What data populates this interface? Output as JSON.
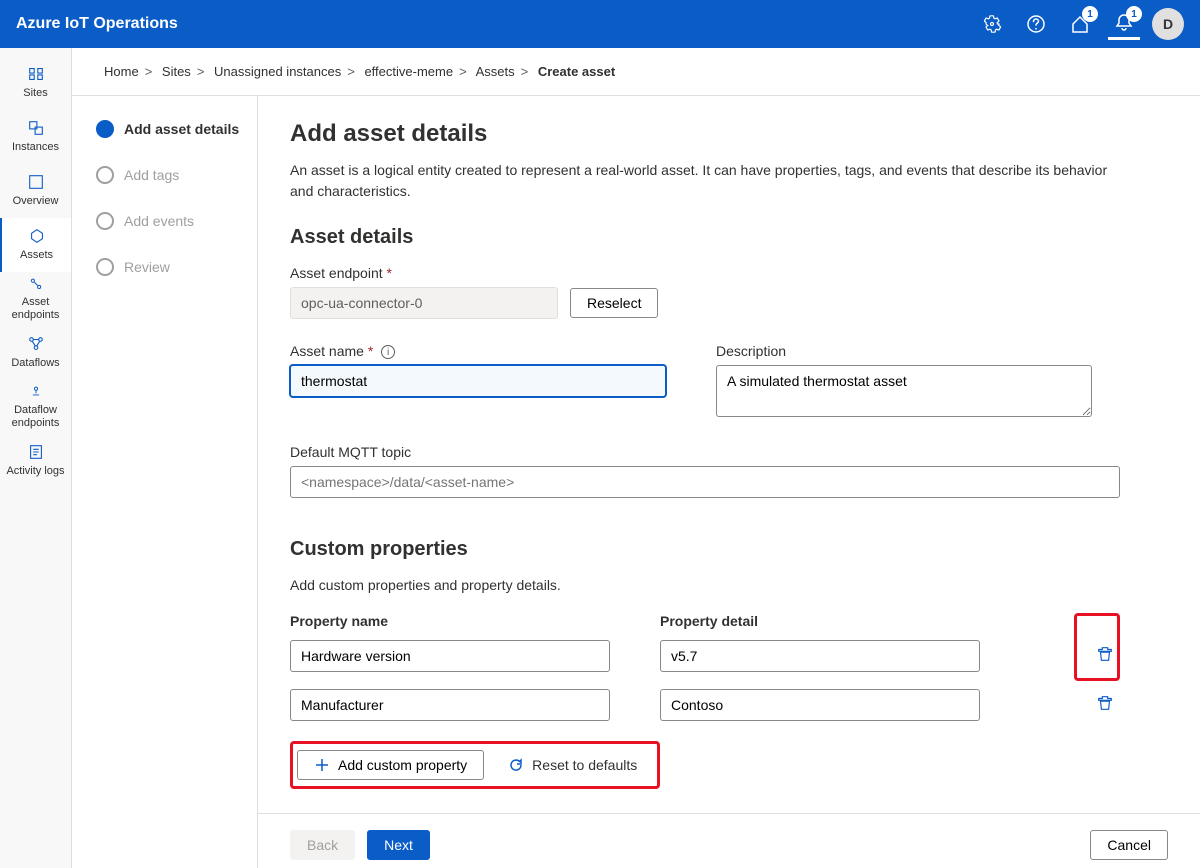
{
  "header": {
    "title": "Azure IoT Operations",
    "badge1": "1",
    "badge2": "1",
    "avatar": "D"
  },
  "sidebar": {
    "items": [
      {
        "label": "Sites"
      },
      {
        "label": "Instances"
      },
      {
        "label": "Overview"
      },
      {
        "label": "Assets"
      },
      {
        "label": "Asset endpoints"
      },
      {
        "label": "Dataflows"
      },
      {
        "label": "Dataflow endpoints"
      },
      {
        "label": "Activity logs"
      }
    ]
  },
  "breadcrumb": {
    "items": [
      "Home",
      "Sites",
      "Unassigned instances",
      "effective-meme",
      "Assets"
    ],
    "current": "Create asset"
  },
  "steps": [
    {
      "label": "Add asset details"
    },
    {
      "label": "Add tags"
    },
    {
      "label": "Add events"
    },
    {
      "label": "Review"
    }
  ],
  "page": {
    "title": "Add asset details",
    "description": "An asset is a logical entity created to represent a real-world asset. It can have properties, tags, and events that describe its behavior and characteristics."
  },
  "details": {
    "sectionTitle": "Asset details",
    "endpointLabel": "Asset endpoint",
    "endpointValue": "opc-ua-connector-0",
    "reselectLabel": "Reselect",
    "nameLabel": "Asset name",
    "nameValue": "thermostat",
    "descLabel": "Description",
    "descValue": "A simulated thermostat asset",
    "mqttLabel": "Default MQTT topic",
    "mqttPlaceholder": "<namespace>/data/<asset-name>"
  },
  "customProps": {
    "sectionTitle": "Custom properties",
    "subtitle": "Add custom properties and property details.",
    "nameHeader": "Property name",
    "detailHeader": "Property detail",
    "rows": [
      {
        "name": "Hardware version",
        "detail": "v5.7"
      },
      {
        "name": "Manufacturer",
        "detail": "Contoso"
      }
    ],
    "addLabel": "Add custom property",
    "resetLabel": "Reset to defaults"
  },
  "footer": {
    "back": "Back",
    "next": "Next",
    "cancel": "Cancel"
  }
}
